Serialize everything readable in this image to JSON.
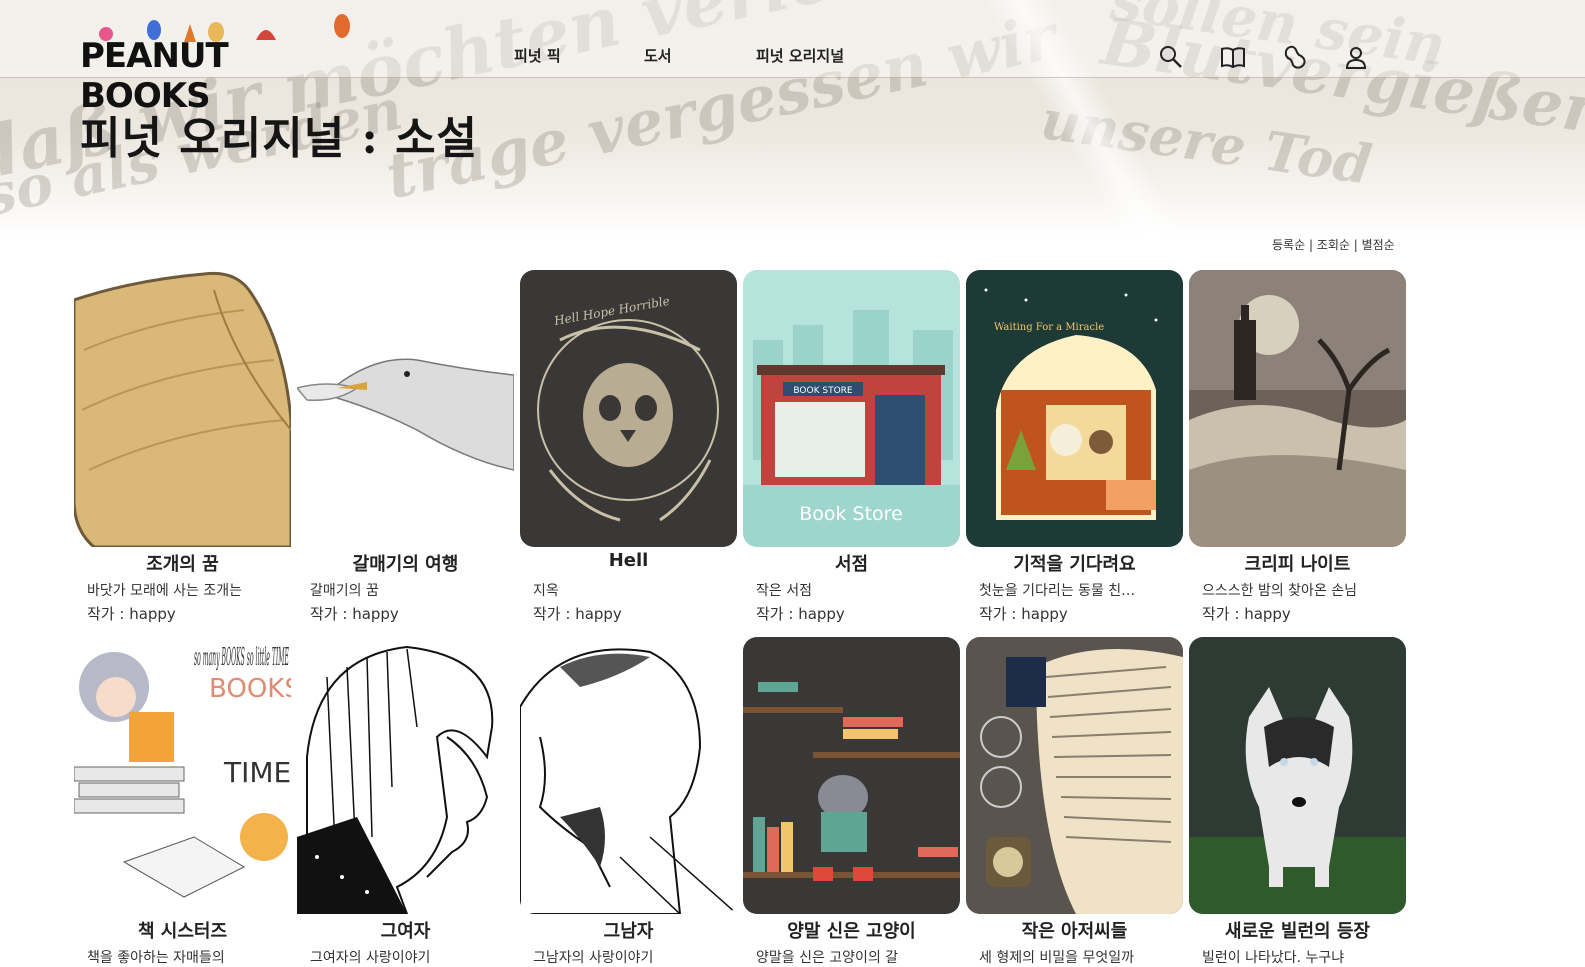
{
  "header": {
    "logo_text": "PEANUT BOOKS",
    "nav": [
      "피넛 픽",
      "도서",
      "피넛 오리지널"
    ],
    "icons": [
      "search-icon",
      "book-icon",
      "peanut-icon",
      "user-icon"
    ]
  },
  "page_title": "피넛 오리지널 : 소설",
  "sort": {
    "options": [
      "등록순",
      "조회순",
      "별점순"
    ],
    "separator": " | "
  },
  "books_row1": [
    {
      "title": "조개의 꿈",
      "desc": "바닷가 모래에 사는 조개는",
      "author": "작가 : happy"
    },
    {
      "title": "갈매기의 여행",
      "desc": "갈매기의 꿈",
      "author": "작가 : happy"
    },
    {
      "title": "Hell",
      "desc": "지옥",
      "author": "작가 : happy"
    },
    {
      "title": "서점",
      "desc": "작은 서점",
      "author": "작가 : happy"
    },
    {
      "title": "기적을 기다려요",
      "desc": "첫눈을 기다리는 동물 친…",
      "author": "작가 : happy"
    },
    {
      "title": "크리피 나이트",
      "desc": "으스스한 밤의 찾아온 손님",
      "author": "작가 : happy"
    }
  ],
  "books_row2": [
    {
      "title": "책 시스터즈",
      "desc": "책을 좋아하는 자매들의"
    },
    {
      "title": "그여자",
      "desc": "그여자의 사랑이야기"
    },
    {
      "title": "그남자",
      "desc": "그남자의 사랑이야기"
    },
    {
      "title": "양말 신은 고양이",
      "desc": "양말을 신은 고양이의 갈"
    },
    {
      "title": "작은 아저씨들",
      "desc": "세 형제의 비밀을 무엇일까"
    },
    {
      "title": "새로운 빌런의 등장",
      "desc": "빌런이 나타났다. 누구냐"
    }
  ],
  "cover_labels": {
    "bookstore_sign": "BOOK STORE",
    "bookstore_caption": "Book Store",
    "miracle": "Waiting For a Miracle",
    "hell": "Hell Hope Horrible",
    "sisters": "so many BOOKS so little TIME"
  }
}
